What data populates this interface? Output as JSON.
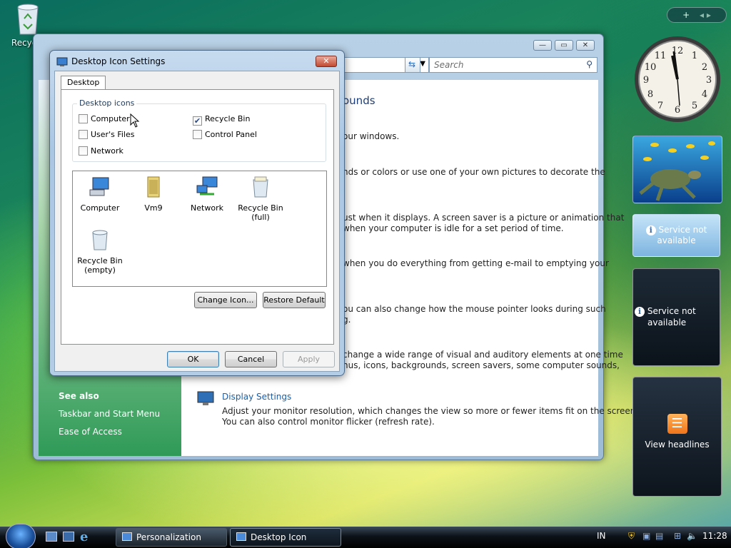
{
  "desktop": {
    "recycle_label": "Recycle"
  },
  "personalization": {
    "search_placeholder": "Search",
    "heading_fragment": "ounds",
    "lines": [
      "our windows.",
      "nds or colors or use one of your own pictures to decorate the",
      "ust when it displays. A screen saver is a picture or animation that",
      "when your computer is idle for a set period of time.",
      "when you do everything from getting e-mail to emptying your",
      "ou can also change how the mouse pointer looks during such",
      "g.",
      "change a wide range of visual and auditory elements at one time",
      "nus, icons, backgrounds, screen savers, some computer sounds,"
    ],
    "display_settings_link": "Display Settings",
    "display_settings_desc1": "Adjust your monitor resolution, which changes the view so more or fewer items fit on the screen.",
    "display_settings_desc2": "You can also control monitor flicker (refresh rate).",
    "see_also": "See also",
    "taskbar_link": "Taskbar and Start Menu",
    "ease_link": "Ease of Access"
  },
  "dialog": {
    "title": "Desktop Icon Settings",
    "close_glyph": "✕",
    "tab": "Desktop",
    "group_label": "Desktop icons",
    "checkboxes": [
      {
        "label": "Computer",
        "checked": false
      },
      {
        "label": "Recycle Bin",
        "checked": true
      },
      {
        "label": "User's Files",
        "checked": false
      },
      {
        "label": "Control Panel",
        "checked": false
      },
      {
        "label": "Network",
        "checked": false
      }
    ],
    "icons": [
      {
        "label": "Computer",
        "icon": "computer-icon"
      },
      {
        "label": "Vm9",
        "icon": "user-folder-icon"
      },
      {
        "label": "Network",
        "icon": "network-icon"
      },
      {
        "label": "Recycle Bin (full)",
        "line1": "Recycle Bin",
        "line2": "(full)",
        "icon": "recycle-bin-full-icon"
      },
      {
        "label": "Recycle Bin (empty)",
        "line1": "Recycle Bin",
        "line2": "(empty)",
        "icon": "recycle-bin-empty-icon"
      }
    ],
    "change_icon": "Change Icon...",
    "restore_default": "Restore Default",
    "ok": "OK",
    "cancel": "Cancel",
    "apply": "Apply"
  },
  "sidebar": {
    "service1": "Service not available",
    "service2_line1": "Service not",
    "service2_line2": "available",
    "headlines": "View headlines"
  },
  "taskbar": {
    "items": [
      "Personalization",
      "Desktop Icon Settings"
    ],
    "lang": "IN",
    "time": "11:28"
  },
  "colors": {
    "link": "#1a5ea8",
    "accent": "#3c7fb1"
  }
}
